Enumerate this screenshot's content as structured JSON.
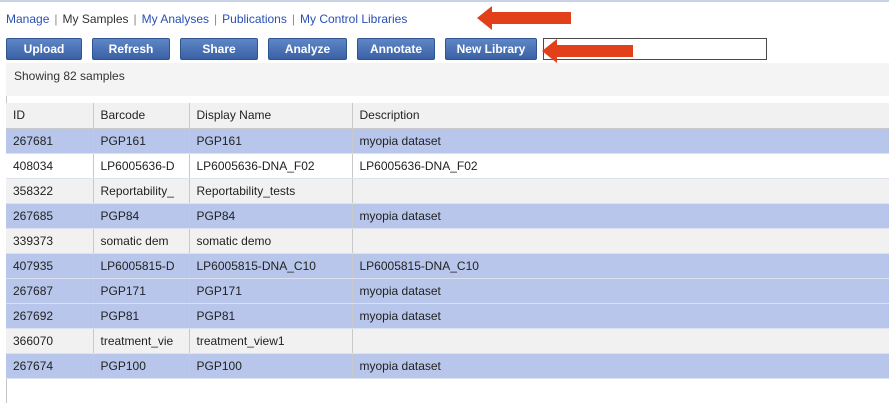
{
  "nav": {
    "manage": "Manage",
    "my_samples": "My Samples",
    "my_analyses": "My Analyses",
    "publications": "Publications",
    "my_control_libraries": "My Control Libraries",
    "separator": "|"
  },
  "toolbar": {
    "upload": "Upload",
    "refresh": "Refresh",
    "share": "Share",
    "analyze": "Analyze",
    "annotate": "Annotate",
    "new_library": "New Library",
    "search_value": ""
  },
  "status": {
    "showing": "Showing 82 samples"
  },
  "table": {
    "headers": {
      "id": "ID",
      "barcode": "Barcode",
      "display_name": "Display Name",
      "description": "Description"
    },
    "rows": [
      {
        "id": "267681",
        "barcode": "PGP161",
        "display_name": "PGP161",
        "description": "myopia dataset"
      },
      {
        "id": "408034",
        "barcode": "LP6005636-D",
        "display_name": "LP6005636-DNA_F02",
        "description": "LP6005636-DNA_F02"
      },
      {
        "id": "358322",
        "barcode": "Reportability_",
        "display_name": "Reportability_tests",
        "description": ""
      },
      {
        "id": "267685",
        "barcode": "PGP84",
        "display_name": "PGP84",
        "description": "myopia dataset"
      },
      {
        "id": "339373",
        "barcode": "somatic dem",
        "display_name": "somatic demo",
        "description": ""
      },
      {
        "id": "407935",
        "barcode": "LP6005815-D",
        "display_name": "LP6005815-DNA_C10",
        "description": "LP6005815-DNA_C10"
      },
      {
        "id": "267687",
        "barcode": "PGP171",
        "display_name": "PGP171",
        "description": "myopia dataset"
      },
      {
        "id": "267692",
        "barcode": "PGP81",
        "display_name": "PGP81",
        "description": "myopia dataset"
      },
      {
        "id": "366070",
        "barcode": "treatment_vie",
        "display_name": "treatment_view1",
        "description": ""
      },
      {
        "id": "267674",
        "barcode": "PGP100",
        "display_name": "PGP100",
        "description": "myopia dataset"
      }
    ]
  },
  "colors": {
    "selected_row": "#b7c6ea",
    "button": "#4a72b6",
    "arrow": "#e2401b",
    "link": "#2a4fb5"
  }
}
